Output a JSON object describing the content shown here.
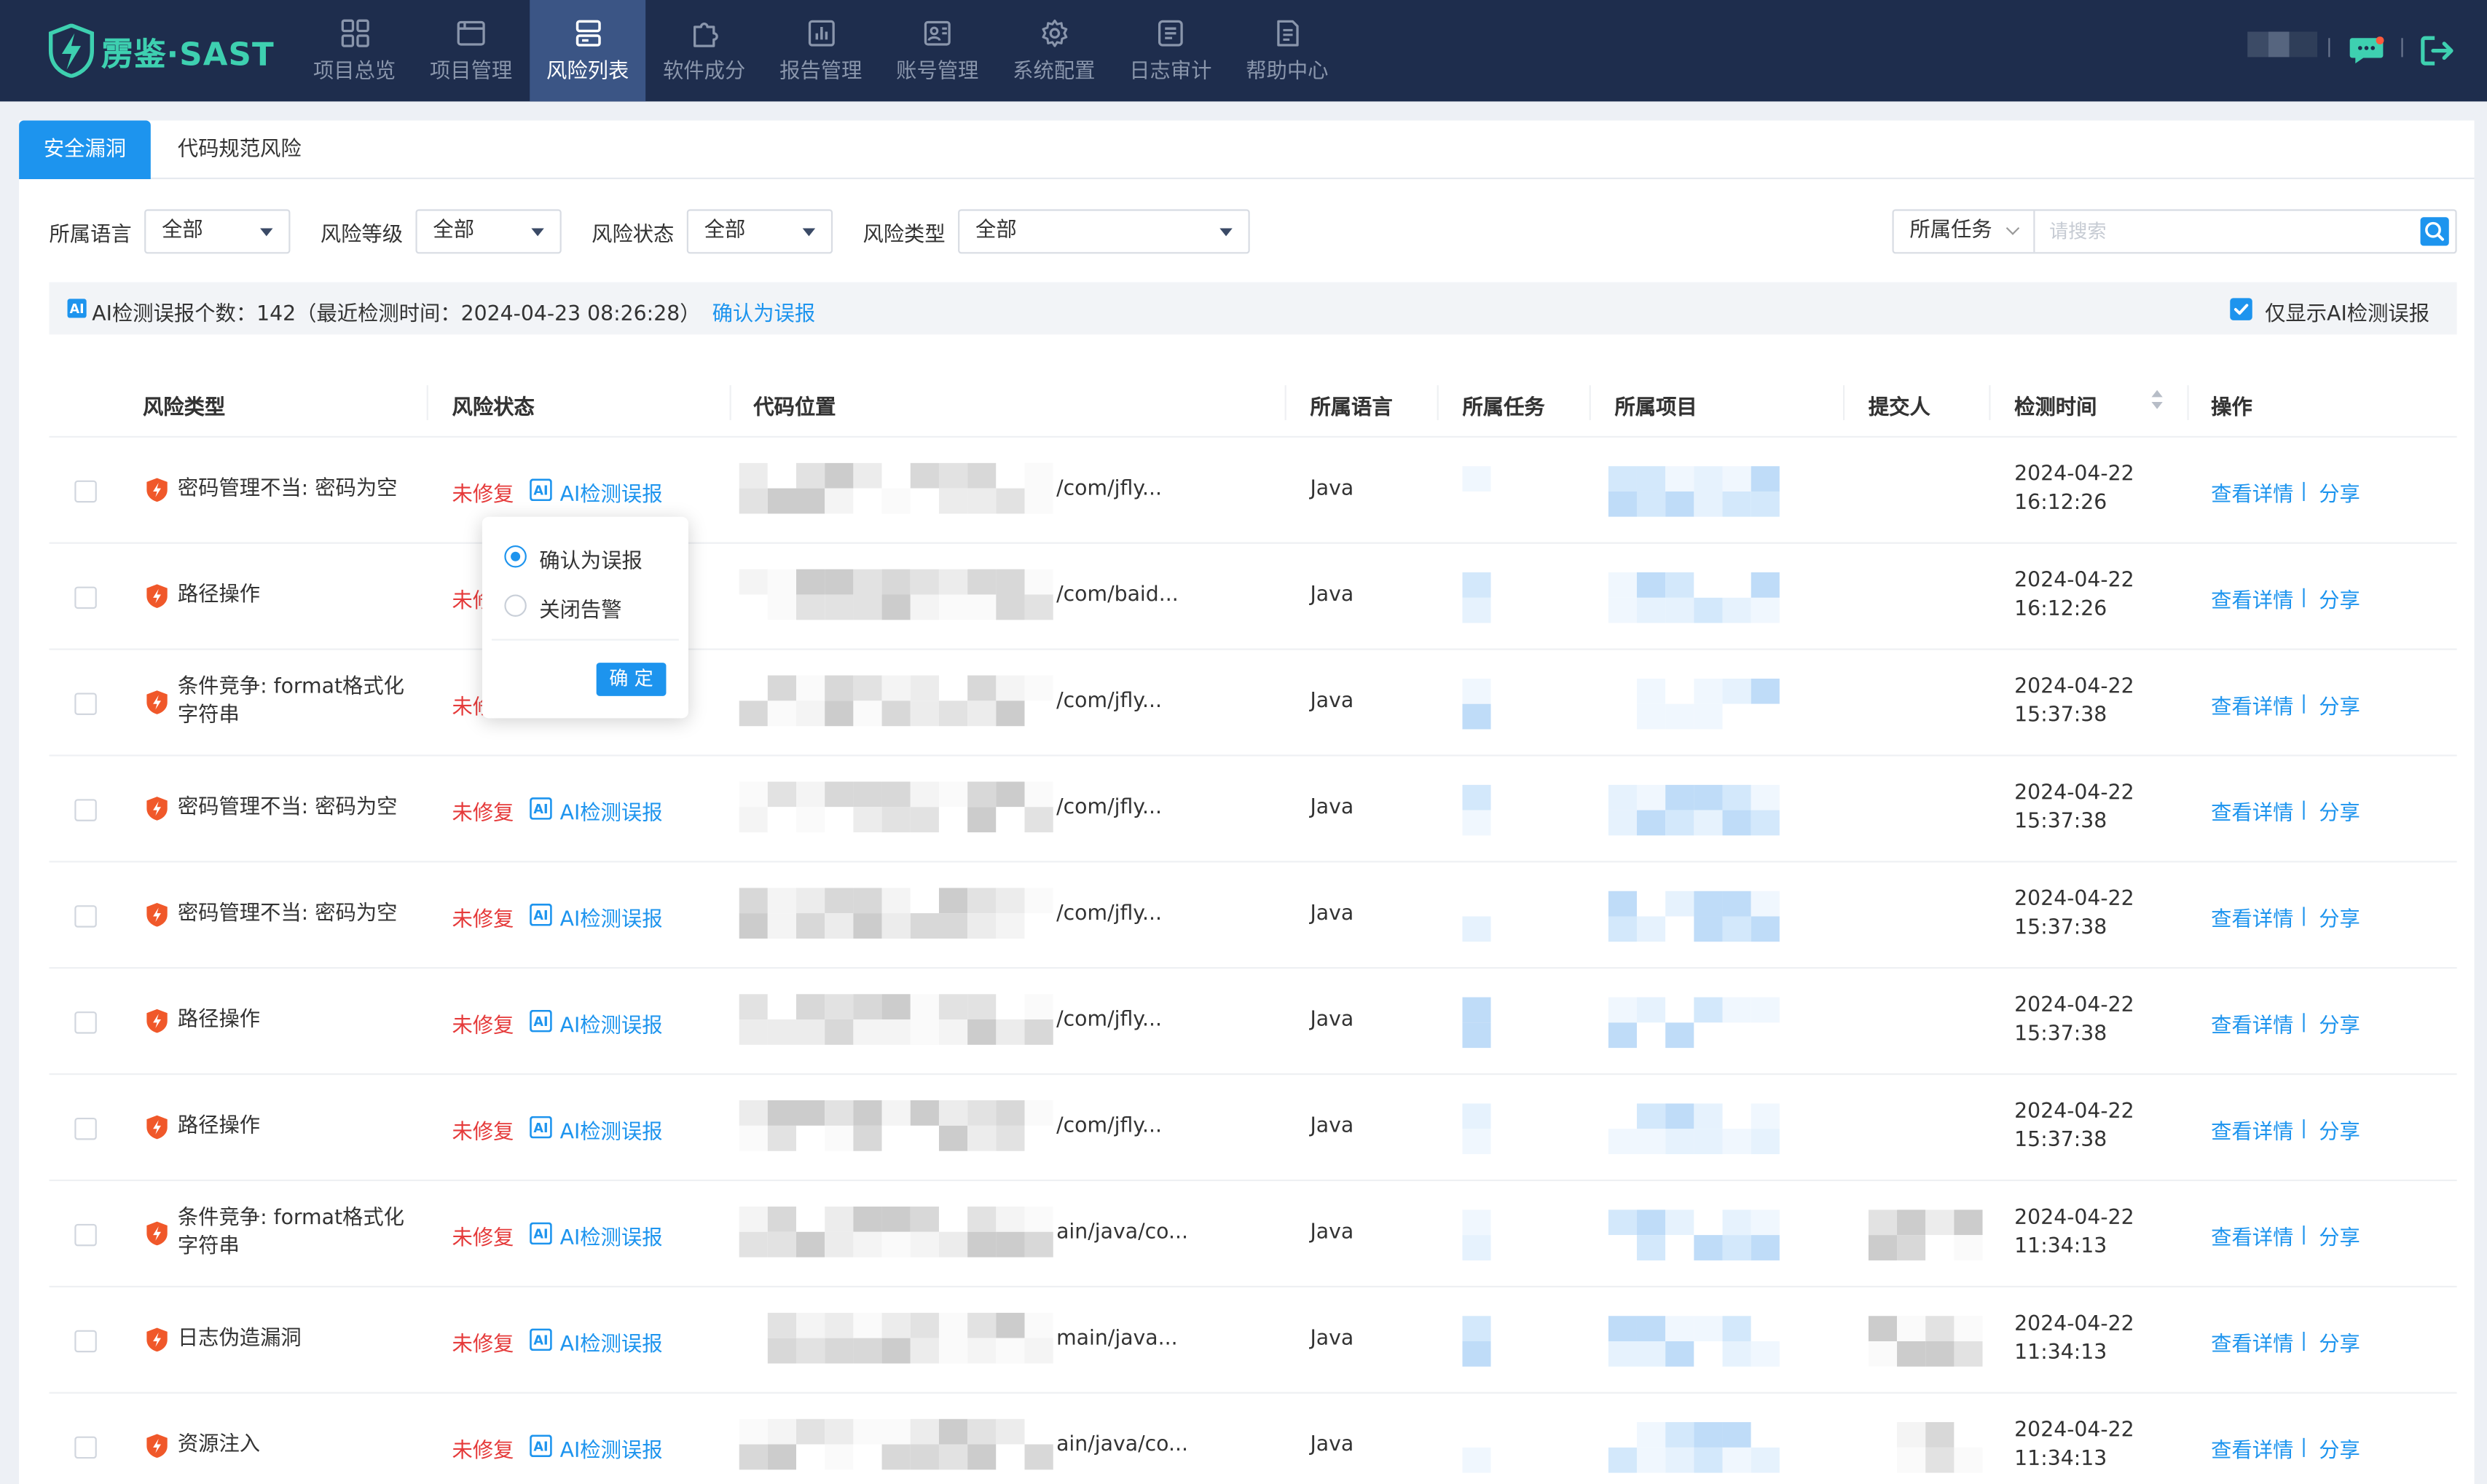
{
  "brand": {
    "name": "雳鉴·SAST",
    "color": "#3ed0b0"
  },
  "colors": {
    "nav_bg": "#1e2d4d",
    "nav_active": "#3b5585",
    "accent": "#1d94ee",
    "danger": "#e53a3a",
    "shield": "#f0582a"
  },
  "nav": {
    "items": [
      {
        "label": "项目总览",
        "icon": "grid-icon"
      },
      {
        "label": "项目管理",
        "icon": "folder-icon"
      },
      {
        "label": "风险列表",
        "icon": "stack-icon",
        "active": true
      },
      {
        "label": "软件成分",
        "icon": "puzzle-icon"
      },
      {
        "label": "报告管理",
        "icon": "chart-icon"
      },
      {
        "label": "账号管理",
        "icon": "user-card-icon"
      },
      {
        "label": "系统配置",
        "icon": "gear-icon"
      },
      {
        "label": "日志审计",
        "icon": "log-icon"
      },
      {
        "label": "帮助中心",
        "icon": "document-icon"
      }
    ]
  },
  "tabs": [
    {
      "label": "安全漏洞",
      "active": true
    },
    {
      "label": "代码规范风险",
      "active": false
    }
  ],
  "filters": {
    "language": {
      "label": "所属语言",
      "value": "全部"
    },
    "level": {
      "label": "风险等级",
      "value": "全部"
    },
    "status": {
      "label": "风险状态",
      "value": "全部"
    },
    "type": {
      "label": "风险类型",
      "value": "全部"
    },
    "task_select": "所属任务",
    "search_placeholder": "请搜索"
  },
  "ai_bar": {
    "text": "AI检测误报个数：142（最近检测时间：2024-04-23 08:26:28）",
    "action": "确认为误报",
    "checkbox_label": "仅显示AI检测误报",
    "checked": true
  },
  "table": {
    "headers": {
      "type": "风险类型",
      "status": "风险状态",
      "location": "代码位置",
      "language": "所属语言",
      "task": "所属任务",
      "project": "所属项目",
      "submitter": "提交人",
      "time": "检测时间",
      "ops": "操作"
    },
    "ai_tag": "AI检测误报",
    "view": "查看详情",
    "share": "分享",
    "rows": [
      {
        "type": "密码管理不当: 密码为空",
        "status": "未修复",
        "path": "/com/jfly...",
        "lang": "Java",
        "date": "2024-04-22",
        "time": "16:12:26"
      },
      {
        "type": "路径操作",
        "status": "未修复",
        "path": "/com/baid...",
        "lang": "Java",
        "date": "2024-04-22",
        "time": "16:12:26"
      },
      {
        "type": "条件竞争: format格式化字符串",
        "status": "未修复",
        "path": "/com/jfly...",
        "lang": "Java",
        "date": "2024-04-22",
        "time": "15:37:38"
      },
      {
        "type": "密码管理不当: 密码为空",
        "status": "未修复",
        "path": "/com/jfly...",
        "lang": "Java",
        "date": "2024-04-22",
        "time": "15:37:38"
      },
      {
        "type": "密码管理不当: 密码为空",
        "status": "未修复",
        "path": "/com/jfly...",
        "lang": "Java",
        "date": "2024-04-22",
        "time": "15:37:38"
      },
      {
        "type": "路径操作",
        "status": "未修复",
        "path": "/com/jfly...",
        "lang": "Java",
        "date": "2024-04-22",
        "time": "15:37:38"
      },
      {
        "type": "路径操作",
        "status": "未修复",
        "path": "/com/jfly...",
        "lang": "Java",
        "date": "2024-04-22",
        "time": "15:37:38"
      },
      {
        "type": "条件竞争: format格式化字符串",
        "status": "未修复",
        "path": "ain/java/co...",
        "lang": "Java",
        "date": "2024-04-22",
        "time": "11:34:13"
      },
      {
        "type": "日志伪造漏洞",
        "status": "未修复",
        "path": "main/java...",
        "lang": "Java",
        "date": "2024-04-22",
        "time": "11:34:13"
      },
      {
        "type": "资源注入",
        "status": "未修复",
        "path": "ain/java/co...",
        "lang": "Java",
        "date": "2024-04-22",
        "time": "11:34:13"
      }
    ]
  },
  "popover": {
    "options": [
      {
        "label": "确认为误报",
        "selected": true
      },
      {
        "label": "关闭告警",
        "selected": false
      }
    ],
    "confirm": "确 定"
  }
}
